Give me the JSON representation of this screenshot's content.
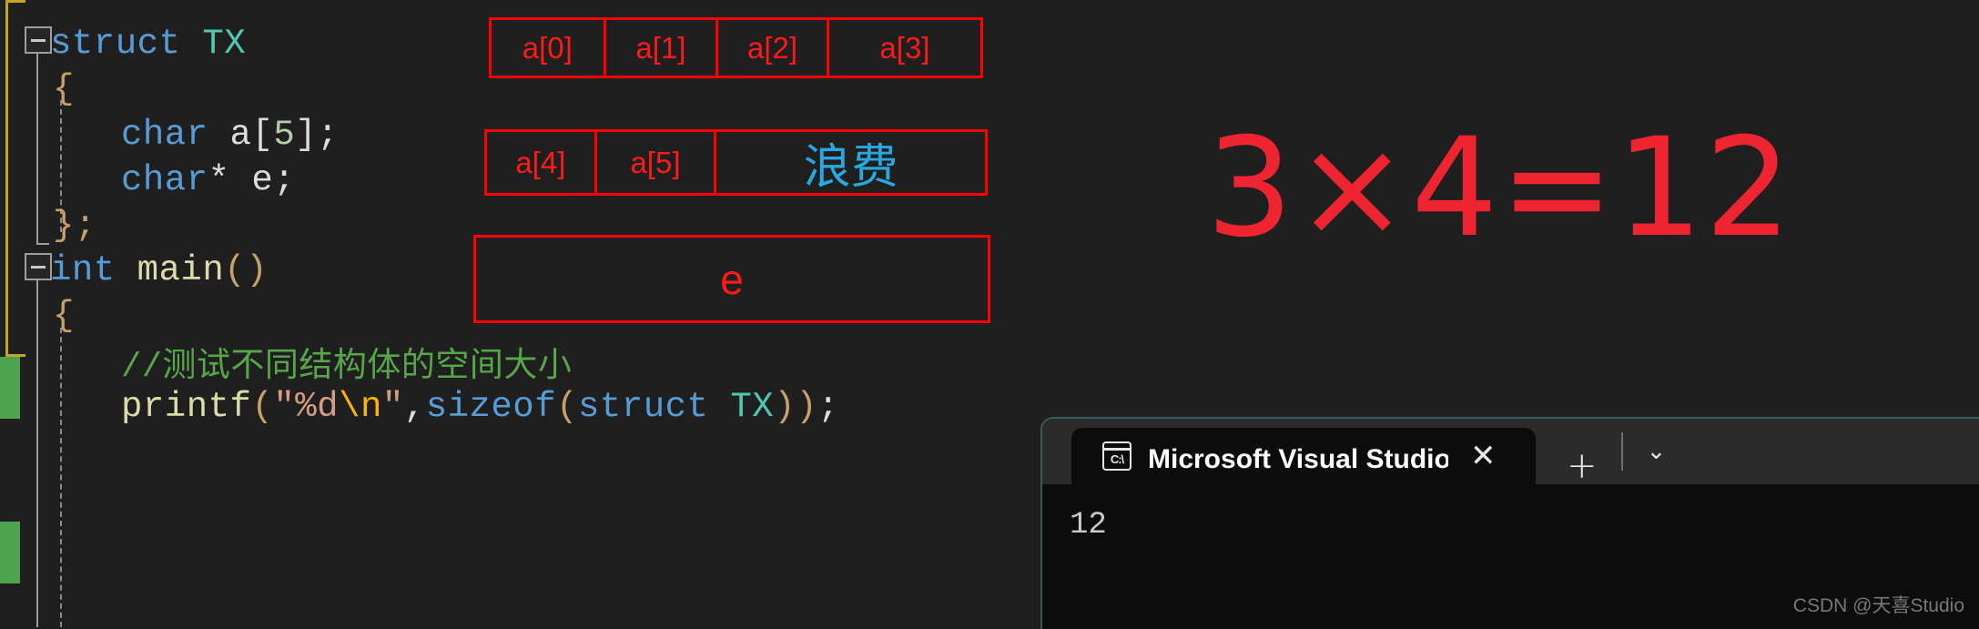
{
  "editor": {
    "code_lines": [
      {
        "indent": 0,
        "tokens": [
          {
            "t": "struct ",
            "c": "kw"
          },
          {
            "t": "TX",
            "c": "type"
          }
        ]
      },
      {
        "indent": 1,
        "tokens": [
          {
            "t": "{",
            "c": "brkt"
          }
        ]
      },
      {
        "indent": 2,
        "tokens": [
          {
            "t": "char",
            "c": "kw"
          },
          {
            "t": " a",
            "c": "plain"
          },
          {
            "t": "[",
            "c": "plain"
          },
          {
            "t": "5",
            "c": "num"
          },
          {
            "t": "]",
            "c": "plain"
          },
          {
            "t": ";",
            "c": "plain"
          }
        ]
      },
      {
        "indent": 2,
        "tokens": [
          {
            "t": "char",
            "c": "kw"
          },
          {
            "t": "* e;",
            "c": "plain"
          }
        ]
      },
      {
        "indent": 1,
        "tokens": [
          {
            "t": "};",
            "c": "brkt"
          }
        ]
      },
      {
        "indent": 0,
        "tokens": [
          {
            "t": "int ",
            "c": "kw"
          },
          {
            "t": "main",
            "c": "fn"
          },
          {
            "t": "()",
            "c": "brkt"
          }
        ]
      },
      {
        "indent": 1,
        "tokens": [
          {
            "t": "{",
            "c": "brkt"
          }
        ]
      },
      {
        "indent": 2,
        "tokens": [
          {
            "t": "//测试不同结构体的空间大小",
            "c": "cmt"
          }
        ]
      },
      {
        "indent": 2,
        "tokens": [
          {
            "t": "printf",
            "c": "fn"
          },
          {
            "t": "(",
            "c": "brkt"
          },
          {
            "t": "\"%d",
            "c": "str"
          },
          {
            "t": "\\n",
            "c": "esc"
          },
          {
            "t": "\"",
            "c": "str"
          },
          {
            "t": ",",
            "c": "plain"
          },
          {
            "t": "sizeof",
            "c": "kw"
          },
          {
            "t": "(",
            "c": "brkt"
          },
          {
            "t": "struct ",
            "c": "kw"
          },
          {
            "t": "TX",
            "c": "type"
          },
          {
            "t": "))",
            "c": "brkt"
          },
          {
            "t": ";",
            "c": "plain"
          }
        ]
      }
    ]
  },
  "memory_layout": {
    "rows": [
      {
        "name": "row-1",
        "cells": [
          {
            "label": "a[0]",
            "kind": "index"
          },
          {
            "label": "a[1]",
            "kind": "index"
          },
          {
            "label": "a[2]",
            "kind": "index"
          },
          {
            "label": "a[3]",
            "kind": "index"
          }
        ]
      },
      {
        "name": "row-2",
        "cells": [
          {
            "label": "a[4]",
            "kind": "index"
          },
          {
            "label": "a[5]",
            "kind": "index"
          },
          {
            "label": "浪费",
            "kind": "waste"
          }
        ]
      },
      {
        "name": "row-3",
        "cells": [
          {
            "label": "e",
            "kind": "pointer"
          }
        ]
      }
    ],
    "border_color": "#ff0000",
    "index_color": "#ff1a1a",
    "waste_color": "#29a8df"
  },
  "annotation": {
    "equation": "3×4=12",
    "equation_color": "#ee2430"
  },
  "terminal": {
    "tab_title": "Microsoft Visual Studio 调试",
    "tab_icon_label": "C:\\",
    "close_label": "✕",
    "new_tab_label": "+",
    "dropdown_label": "⌄",
    "output_lines": [
      "12"
    ]
  },
  "watermark": {
    "text": "CSDN @天喜Studio"
  }
}
